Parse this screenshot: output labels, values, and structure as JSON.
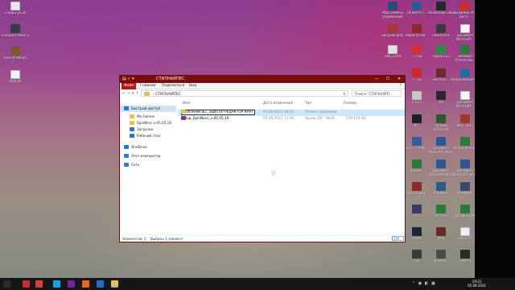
{
  "desktop": {
    "icons": [
      {
        "label": "5 марц ун.20",
        "color": "#e8e8e8",
        "kind": "file"
      },
      {
        "label": "Transport Fever 2",
        "color": "#3a3a46",
        "kind": "app"
      },
      {
        "label": "Rise of Nation",
        "color": "#7a5a2a",
        "kind": "app"
      },
      {
        "label": "mod.dll",
        "color": "#f0f0f0",
        "kind": "file"
      },
      {
        "label": "Мод замены управления",
        "color": "#2a4a7a",
        "kind": "app"
      },
      {
        "label": "ОбЪектСт...",
        "color": "#2a5a9a",
        "kind": "app"
      },
      {
        "label": "Streamlabs OBS",
        "color": "#1f2a2a",
        "kind": "app"
      },
      {
        "label": "Выжимка УРД Бита...",
        "color": "#c83030",
        "kind": "app"
      },
      {
        "label": "рисунок.bmp",
        "color": "#a03a3a",
        "kind": "app"
      },
      {
        "label": "Repair30.da...",
        "color": "#8a2a2a",
        "kind": "app"
      },
      {
        "label": "FileEdi-zion",
        "color": "#3a3a3a",
        "kind": "app"
      },
      {
        "label": "Документ Microsoft...",
        "color": "#f6f6f6",
        "kind": "doc"
      },
      {
        "label": "SAE_2109",
        "color": "#e0e0e0",
        "kind": "file"
      },
      {
        "label": "7.7.92",
        "color": "#d03030",
        "kind": "app"
      },
      {
        "label": "гараж 123",
        "color": "#2a8a4a",
        "kind": "app"
      },
      {
        "label": "Великое Отечестве...",
        "color": "#2a7a3a",
        "kind": "app"
      },
      {
        "label": "7.7.92",
        "color": "#cc2a2a",
        "kind": "app"
      },
      {
        "label": "жёлтое...",
        "color": "#6a2a2a",
        "kind": "app"
      },
      {
        "label": "Копия Великое...",
        "color": "#2a6a9a",
        "kind": "app"
      },
      {
        "label": "1.13.7",
        "color": "#c8c8c8",
        "kind": "file"
      },
      {
        "label": "1а",
        "color": "#2a2a2a",
        "kind": "app"
      },
      {
        "label": "Документ Microsoft...",
        "color": "#f6f6f6",
        "kind": "doc"
      },
      {
        "label": "#...",
        "color": "#1f1f1f",
        "kind": "app"
      },
      {
        "label": "Ярлыки AUTOCAD",
        "color": "#2a5a2a",
        "kind": "app"
      },
      {
        "label": "WOT 2017",
        "color": "#9a3a2a",
        "kind": "app"
      },
      {
        "label": "ПОСТ-ПРОФ...",
        "color": "#3a5a9a",
        "kind": "app"
      },
      {
        "label": "Документ Microsoft Word",
        "color": "#2b5797",
        "kind": "word"
      },
      {
        "label": "Копия ИГРЫ...",
        "color": "#2a7a3a",
        "kind": "excel"
      },
      {
        "label": "Копия...",
        "color": "#2a7a3a",
        "kind": "excel"
      },
      {
        "label": "Документ Microsoft Word",
        "color": "#2b5797",
        "kind": "word"
      },
      {
        "label": "Документ Microsoft Word",
        "color": "#2b5797",
        "kind": "word"
      },
      {
        "label": "WSCS 2020",
        "color": "#8a2a2a",
        "kind": "app"
      },
      {
        "label": "ТИРАЖАН...",
        "color": "#2a5a8a",
        "kind": "app"
      },
      {
        "label": "ТИРАЖАН...",
        "color": "#3a4a6a",
        "kind": "app"
      },
      {
        "label": "ЭТ...",
        "color": "#3a3a6a",
        "kind": "app"
      },
      {
        "label": "Тест по...",
        "color": "#2a7a3a",
        "kind": "excel"
      },
      {
        "label": "Ярлык СЕЙФ",
        "color": "#2a7a3a",
        "kind": "app"
      },
      {
        "label": "Steam",
        "color": "#1b2838",
        "kind": "app"
      },
      {
        "label": "VMS",
        "color": "#6a2a2a",
        "kind": "app"
      },
      {
        "label": "Bitsio.txt",
        "color": "#f0f0f0",
        "kind": "file"
      },
      {
        "label": "FW",
        "color": "#3a3a3a",
        "kind": "app"
      },
      {
        "label": "Rosetta...",
        "color": "#4a4a4a",
        "kind": "app"
      },
      {
        "label": "EPW14",
        "color": "#2a2a2a",
        "kind": "app"
      },
      {
        "label": "Bitsio 3.3",
        "color": "#8a2a2a",
        "kind": "app"
      },
      {
        "label": "Стилнайпе...",
        "color": "#3a3a4a",
        "kind": "app"
      },
      {
        "label": "TL...",
        "color": "#2a2a2a",
        "kind": "app"
      },
      {
        "label": "ПОСТ-ПРОФ...",
        "color": "#2b5797",
        "kind": "word"
      }
    ]
  },
  "window": {
    "title": "СТИЛНАЙПЕС",
    "quick_access": "▤ ✓ ▾",
    "buttons": {
      "minimize": "—",
      "maximize": "☐",
      "close": "✕"
    },
    "ribbon_tabs": [
      "Файл",
      "Главная",
      "Поделиться",
      "Вид"
    ],
    "help": "?",
    "address": {
      "back": "←",
      "forward": "→",
      "up_history": "▾",
      "up": "↑",
      "path": "› СТИЛНАЙПЕС",
      "path_dropdown": "▾",
      "refresh": "↻",
      "search_placeholder": "Поиск: СТИЛНАЙП..."
    },
    "nav_pane": [
      {
        "label": "Быстрый доступ",
        "icon": "star",
        "color": "#2b78d0",
        "selected": true
      },
      {
        "label": "My Games",
        "icon": "folder",
        "color": "#e9c04f",
        "selected": false
      },
      {
        "label": "SpinNinci v.05.05.16",
        "icon": "folder",
        "color": "#e9c04f",
        "selected": false
      },
      {
        "label": "Загрузки",
        "icon": "download",
        "color": "#2b78d0",
        "selected": false
      },
      {
        "label": "Рабочий стол",
        "icon": "desktop",
        "color": "#2b78d0",
        "selected": false
      },
      {
        "label": "OneDrive",
        "icon": "cloud",
        "color": "#2b78d0",
        "selected": false
      },
      {
        "label": "Этот компьютер",
        "icon": "computer",
        "color": "#3a7cc8",
        "selected": false
      },
      {
        "label": "Сеть",
        "icon": "network",
        "color": "#3a7cc8",
        "selected": false
      }
    ],
    "columns": [
      "Имя",
      "Дата изменения",
      "Тип",
      "Размер"
    ],
    "files": [
      {
        "name": "СТИЛНАЙПЕС_ЭДИТОР РЕДАКТОР КАРТ",
        "date": "05.09.2021 18:21",
        "type": "Папка с файлами",
        "size": "",
        "icon": "folder",
        "color": "#e9c04f",
        "selected": true,
        "renaming": true
      },
      {
        "name": "Setup_SpinNinci_v.05.05.16",
        "date": "05.09.2021 11:06",
        "type": "Архив ZIP - WinR...",
        "size": "538 114 КБ",
        "icon": "zip",
        "color": "#7a3a8a",
        "selected": false,
        "renaming": false
      }
    ],
    "status": {
      "count": "Элементов: 2",
      "selected": "Выбран 1 элемент"
    }
  },
  "taskbar": {
    "items": [
      {
        "name": "start",
        "color": "#2a2a2a"
      },
      {
        "name": "app-1",
        "color": "#c03030"
      },
      {
        "name": "app-2",
        "color": "#d04040"
      },
      {
        "name": "app-3",
        "color": "#1ba1e2"
      },
      {
        "name": "app-4",
        "color": "#6a2a9a"
      },
      {
        "name": "app-5",
        "color": "#e06a20"
      },
      {
        "name": "app-6",
        "color": "#2a6ac8"
      },
      {
        "name": "file-explorer",
        "color": "#e9c04f"
      }
    ],
    "tray": "⌃ ◉ ◧ ▣",
    "time": "19:21",
    "date": "05.09.2021"
  }
}
